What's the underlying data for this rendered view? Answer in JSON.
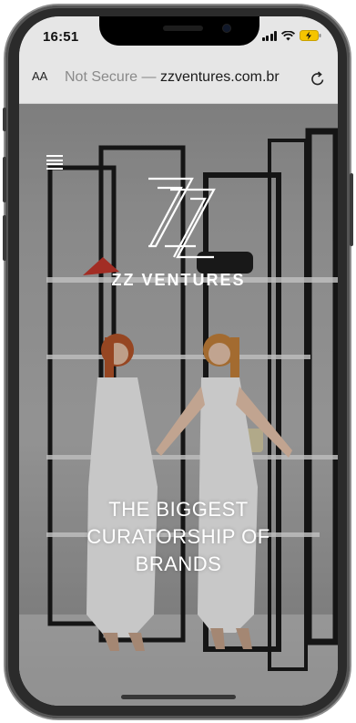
{
  "status_bar": {
    "time": "16:51",
    "icons": [
      "signal-icon",
      "wifi-icon",
      "battery-charging-icon"
    ]
  },
  "browser": {
    "text_size_label": "AA",
    "security_label": "Not Secure",
    "separator": " — ",
    "domain": "zzventures.com.br",
    "reload_icon": "reload-icon"
  },
  "site": {
    "menu_icon": "hamburger-menu-icon",
    "logo_mark": "zz-logo",
    "brand_name": "ZZ VENTURES",
    "tagline_line1": "THE BIGGEST",
    "tagline_line2": "CURATORSHIP OF",
    "tagline_line3": "BRANDS"
  },
  "colors": {
    "browser_chrome": "#e6e6e6",
    "not_secure_text": "#8a8a8a",
    "hero_text": "#ffffff",
    "battery_charging": "#f5c400"
  }
}
